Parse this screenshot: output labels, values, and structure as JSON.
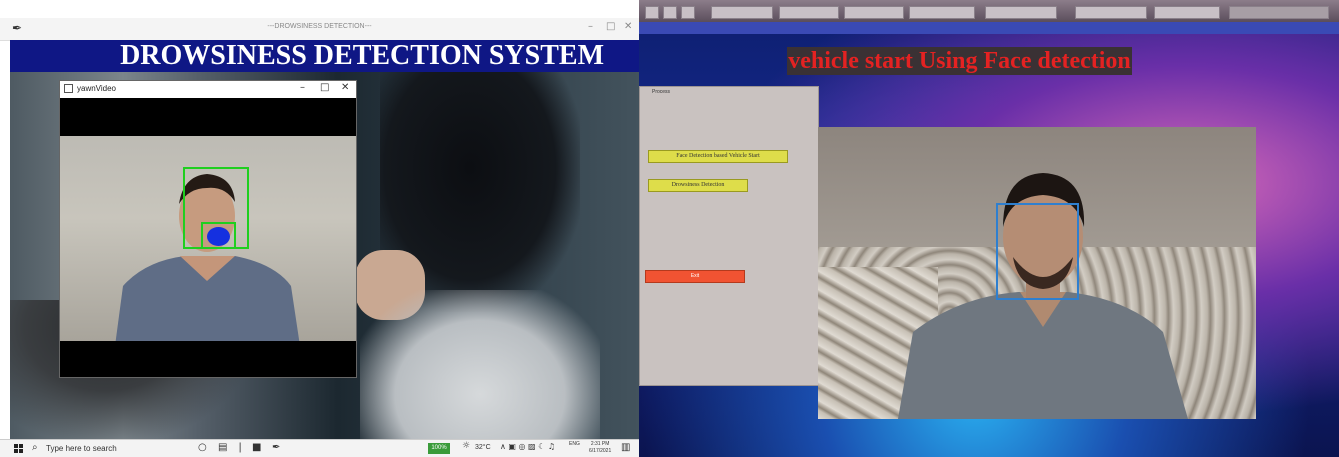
{
  "left": {
    "window_title": "---DROWSINESS DETECTION---",
    "banner_title": "DROWSINESS DETECTION SYSTEM",
    "yawn_window_title": "yawnVideo",
    "taskbar": {
      "search_placeholder": "Type here to search",
      "zoom": "100%",
      "weather": "32°C",
      "lang": "ENG",
      "time": "2:31 PM",
      "date": "6/17/2021"
    }
  },
  "right": {
    "heading": "vehicle start Using Face detection",
    "process_legend": "Process",
    "buttons": {
      "face_detection": "Face Detection based Vehicle Start",
      "drowsiness": "Drowsiness Detection",
      "exit": "Exit"
    }
  },
  "colors": {
    "banner": "#0f1785",
    "detection_box": "#1fcf1f",
    "mouth_fill": "#1530e0",
    "face_box_right": "#2f7fcf",
    "heading_text": "#e42222",
    "button_yellow": "#dedd4a",
    "button_exit": "#f15332"
  }
}
